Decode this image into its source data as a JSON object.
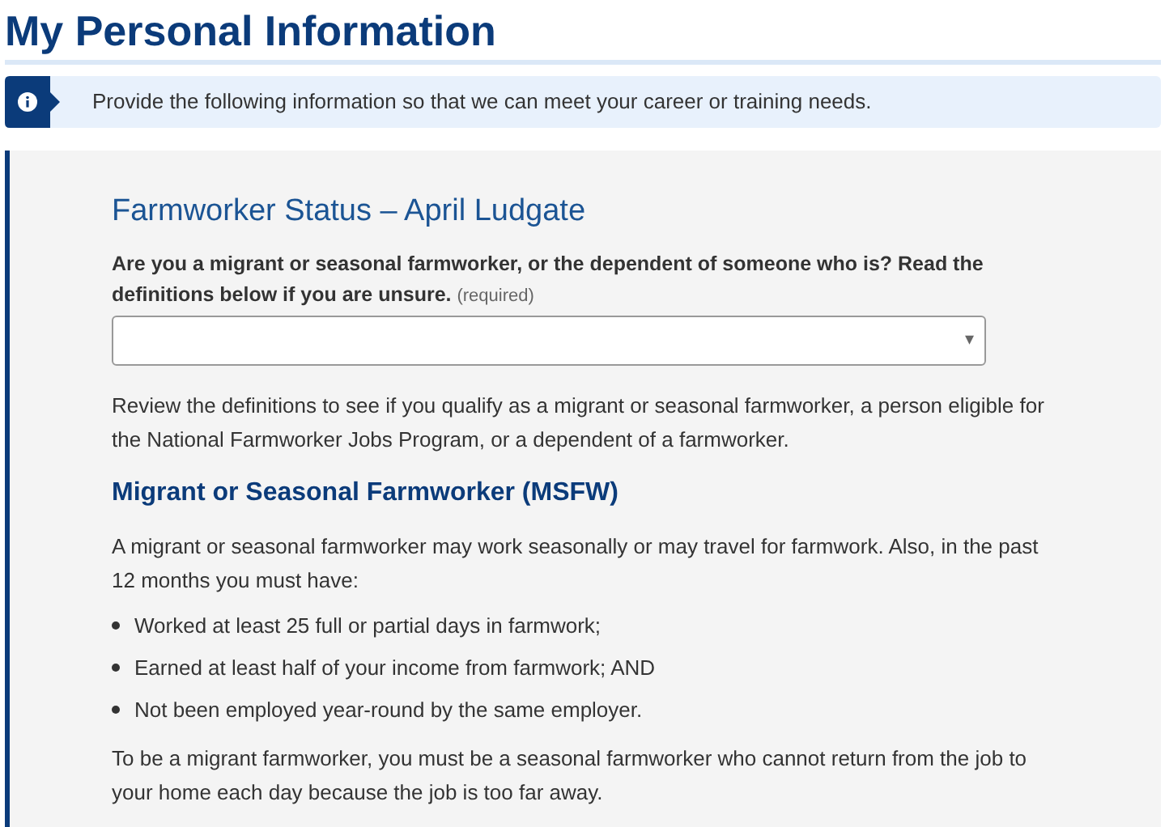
{
  "page_title": "My Personal Information",
  "notice": {
    "text": "Provide the following information so that we can meet your career or training needs."
  },
  "section": {
    "title": "Farmworker Status – April Ludgate",
    "question": {
      "label": "Are you a migrant or seasonal farmworker, or the dependent of someone who is? Read the definitions below if you are unsure.",
      "required": "(required)",
      "caret": "▾"
    },
    "intro": "Review the definitions to see if you qualify as a migrant or seasonal farmworker, a person eligible for the National Farmworker Jobs Program, or a dependent of a farmworker.",
    "subsection": {
      "heading": "Migrant or Seasonal Farmworker (MSFW)",
      "paragraph": "A migrant or seasonal farmworker may work seasonally or may travel for farmwork. Also, in the past 12 months you must have:",
      "bullets": [
        "Worked at least 25 full or partial days in farmwork;",
        "Earned at least half of your income from farmwork; AND",
        "Not been employed year-round by the same employer."
      ],
      "closing": "To be a migrant farmworker, you must be a seasonal farmworker who cannot return from the job to your home each day because the job is too far away."
    }
  }
}
